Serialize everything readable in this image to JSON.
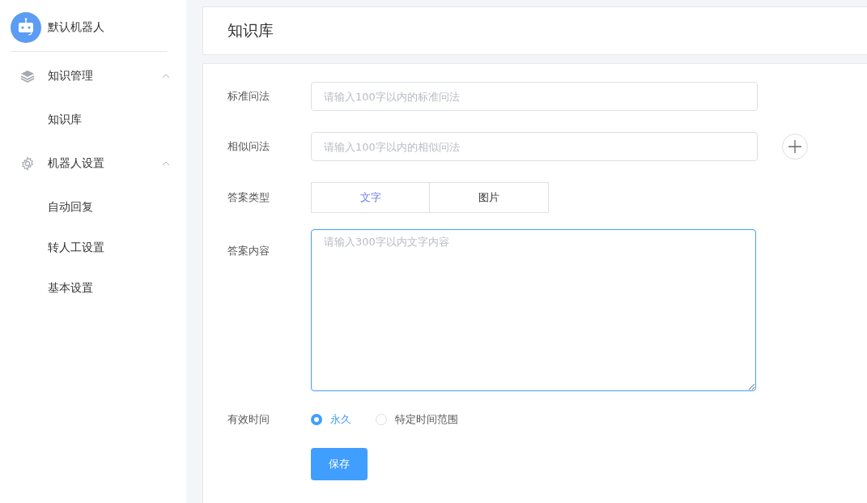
{
  "sidebar": {
    "bot_name": "默认机器人",
    "groups": [
      {
        "kind": "layers",
        "label": "知识管理",
        "expanded": true,
        "children": [
          {
            "label": "知识库"
          }
        ]
      },
      {
        "kind": "gear",
        "label": "机器人设置",
        "expanded": true,
        "children": [
          {
            "label": "自动回复"
          },
          {
            "label": "转人工设置"
          },
          {
            "label": "基本设置"
          }
        ]
      }
    ]
  },
  "page_title": "知识库",
  "form": {
    "standard_question": {
      "label": "标准问法",
      "placeholder": "请输入100字以内的标准问法"
    },
    "similar_question": {
      "label": "相似问法",
      "placeholder": "请输入100字以内的相似问法"
    },
    "answer_type": {
      "label": "答案类型",
      "options": [
        {
          "label": "文字",
          "selected": true
        },
        {
          "label": "图片",
          "selected": false
        }
      ]
    },
    "answer_content": {
      "label": "答案内容",
      "placeholder": "请输入300字以内文字内容"
    },
    "validity": {
      "label": "有效时间",
      "options": [
        {
          "label": "永久",
          "selected": true
        },
        {
          "label": "特定时间范围",
          "selected": false
        }
      ]
    },
    "save_button": "保存"
  }
}
